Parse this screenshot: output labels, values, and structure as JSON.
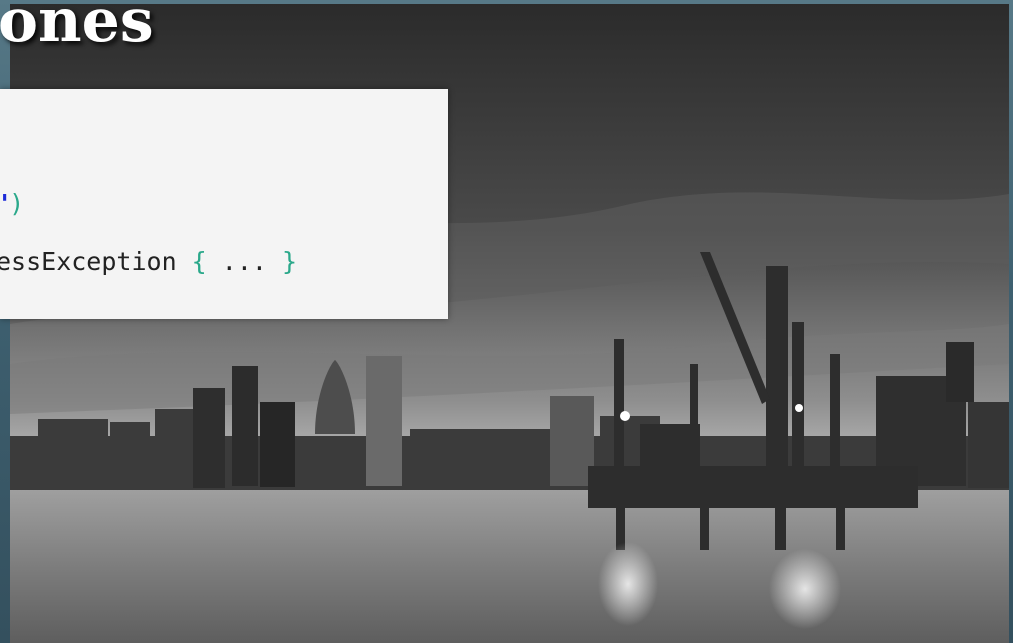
{
  "slide": {
    "title": "ones"
  },
  "code": {
    "line1": {
      "quote": "\"",
      "paren": ")"
    },
    "line2": {
      "text": "essException ",
      "open_brace": "{",
      "ellipsis": " ... ",
      "close_brace": "}"
    }
  },
  "background": {
    "image": "grayscale-city-skyline-with-offshore-platform"
  },
  "colors": {
    "frame": "#3f5f6f",
    "code_panel_bg": "#f4f4f4",
    "string_quote": "#1d2bd8",
    "bracket": "#2aa88a"
  }
}
